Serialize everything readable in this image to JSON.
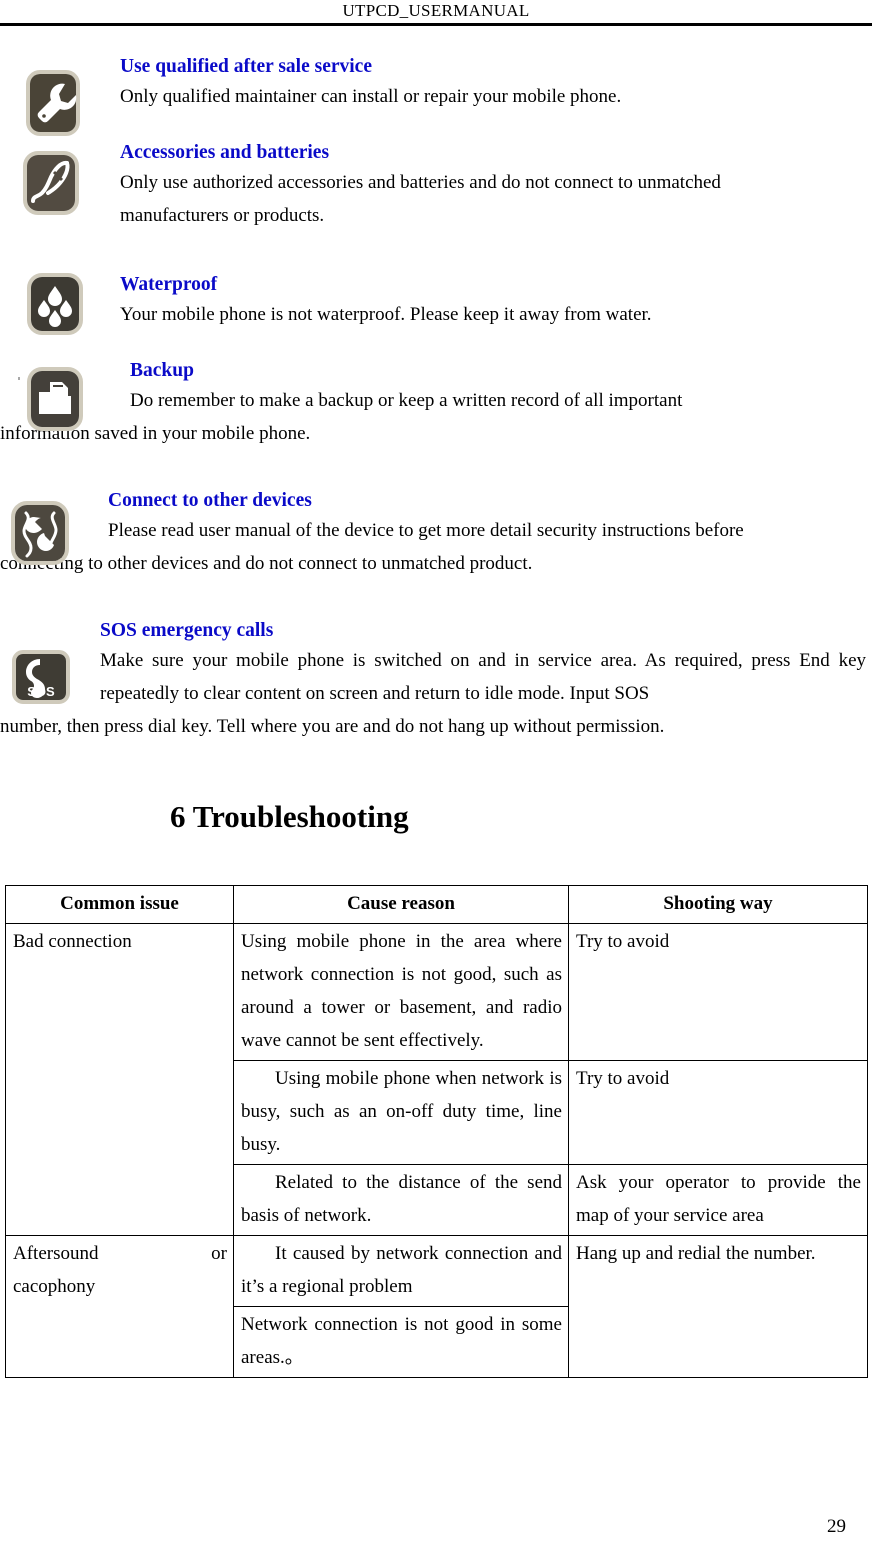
{
  "header": {
    "title": "UTPCD_USERMANUAL"
  },
  "safety_items": [
    {
      "icon": "wrench-icon",
      "heading": "Use qualified after sale service",
      "text": "Only qualified maintainer can install or repair your mobile phone."
    },
    {
      "icon": "battery-accessory-icon",
      "heading": "Accessories and batteries",
      "text": "Only use authorized accessories and batteries and do not connect to unmatched",
      "text2": "manufacturers or products."
    },
    {
      "icon": "water-drops-icon",
      "heading": "Waterproof",
      "text": "Your mobile phone is not waterproof. Please keep it away from water."
    },
    {
      "icon": "folder-backup-icon",
      "heading": "Backup",
      "text": "Do remember to make a backup or keep a written record of all important",
      "text2": "information saved in your mobile phone."
    },
    {
      "icon": "plug-connect-icon",
      "heading": "Connect to other devices",
      "text": "Please read user manual of the device to get more detail security instructions before",
      "text2": "connecting to other devices and do not connect to unmatched product."
    },
    {
      "icon": "sos-phone-icon",
      "heading": "SOS emergency calls",
      "text": "Make sure your mobile phone is switched on and in service area. As required, press End key repeatedly to clear content on screen and return to idle mode. Input SOS",
      "text2": "number, then press dial key. Tell where you are and do not hang up without permission."
    }
  ],
  "section": {
    "title": "6 Troubleshooting"
  },
  "table": {
    "headers": [
      "Common issue",
      "Cause reason",
      "Shooting way"
    ],
    "rows": [
      {
        "issue": "Bad connection",
        "issue_rowspan": 3,
        "cause": "Using mobile phone in the area where network connection is not good, such as around a tower or basement, and radio wave cannot be sent effectively.",
        "way": "Try to avoid",
        "way_rowspan": 1
      },
      {
        "cause": "Using mobile phone when network is busy, such as an on-off duty time, line busy.",
        "way": "Try to avoid",
        "way_rowspan": 1
      },
      {
        "cause": "Related to the distance of the send basis of network.",
        "way": "Ask your operator to provide the map of your service area",
        "way_rowspan": 1
      },
      {
        "issue_line1": "Aftersound",
        "issue_line1_end": "or",
        "issue_line2": "cacophony",
        "issue_rowspan": 2,
        "cause": "It caused by network connection and it’s a regional problem",
        "way": "Hang up and redial the number.",
        "way_rowspan": 2
      },
      {
        "cause": "Network connection is not good in some areas.。"
      }
    ]
  },
  "footer": {
    "page_number": "29"
  },
  "colors": {
    "heading_blue": "#0a0ac8",
    "icon_fill": "#4a4437",
    "text_black": "#000000"
  }
}
